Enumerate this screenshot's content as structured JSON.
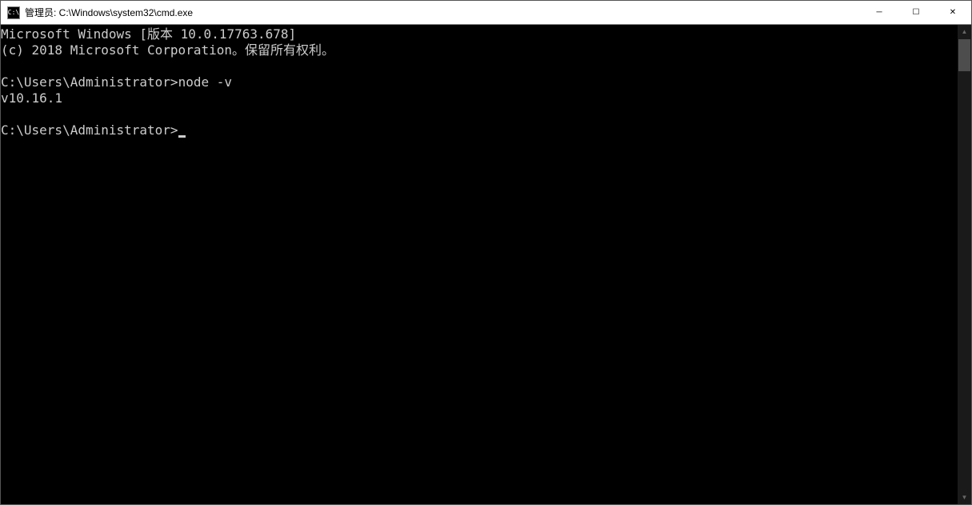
{
  "titlebar": {
    "icon_text": "C:\\",
    "title": "管理员: C:\\Windows\\system32\\cmd.exe"
  },
  "window_controls": {
    "minimize": "─",
    "maximize": "☐",
    "close": "✕"
  },
  "terminal": {
    "line1": "Microsoft Windows [版本 10.0.17763.678]",
    "line2": "(c) 2018 Microsoft Corporation。保留所有权利。",
    "line3": "",
    "line4_prompt": "C:\\Users\\Administrator>",
    "line4_command": "node -v",
    "line5": "v10.16.1",
    "line6": "",
    "line7_prompt": "C:\\Users\\Administrator>"
  }
}
